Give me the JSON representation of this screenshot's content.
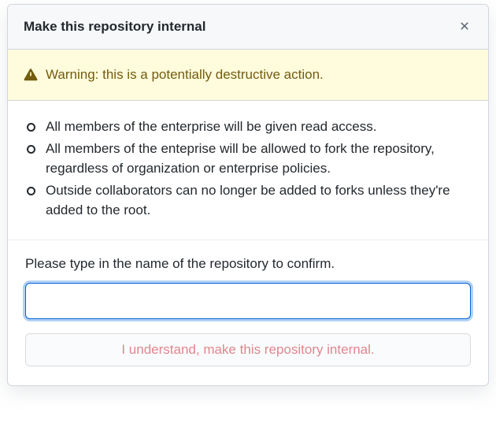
{
  "dialog": {
    "title": "Make this repository internal",
    "warning": "Warning: this is a potentially destructive action.",
    "consequences": [
      "All members of the enterprise will be given read access.",
      "All members of the enteprise will be allowed to fork the repository, regardless of organization or enterprise policies.",
      "Outside collaborators can no longer be added to forks unless they're added to the root."
    ],
    "confirm_prompt": "Please type in the name of the repository to confirm.",
    "input_value": "",
    "button_label": "I understand, make this repository internal."
  }
}
